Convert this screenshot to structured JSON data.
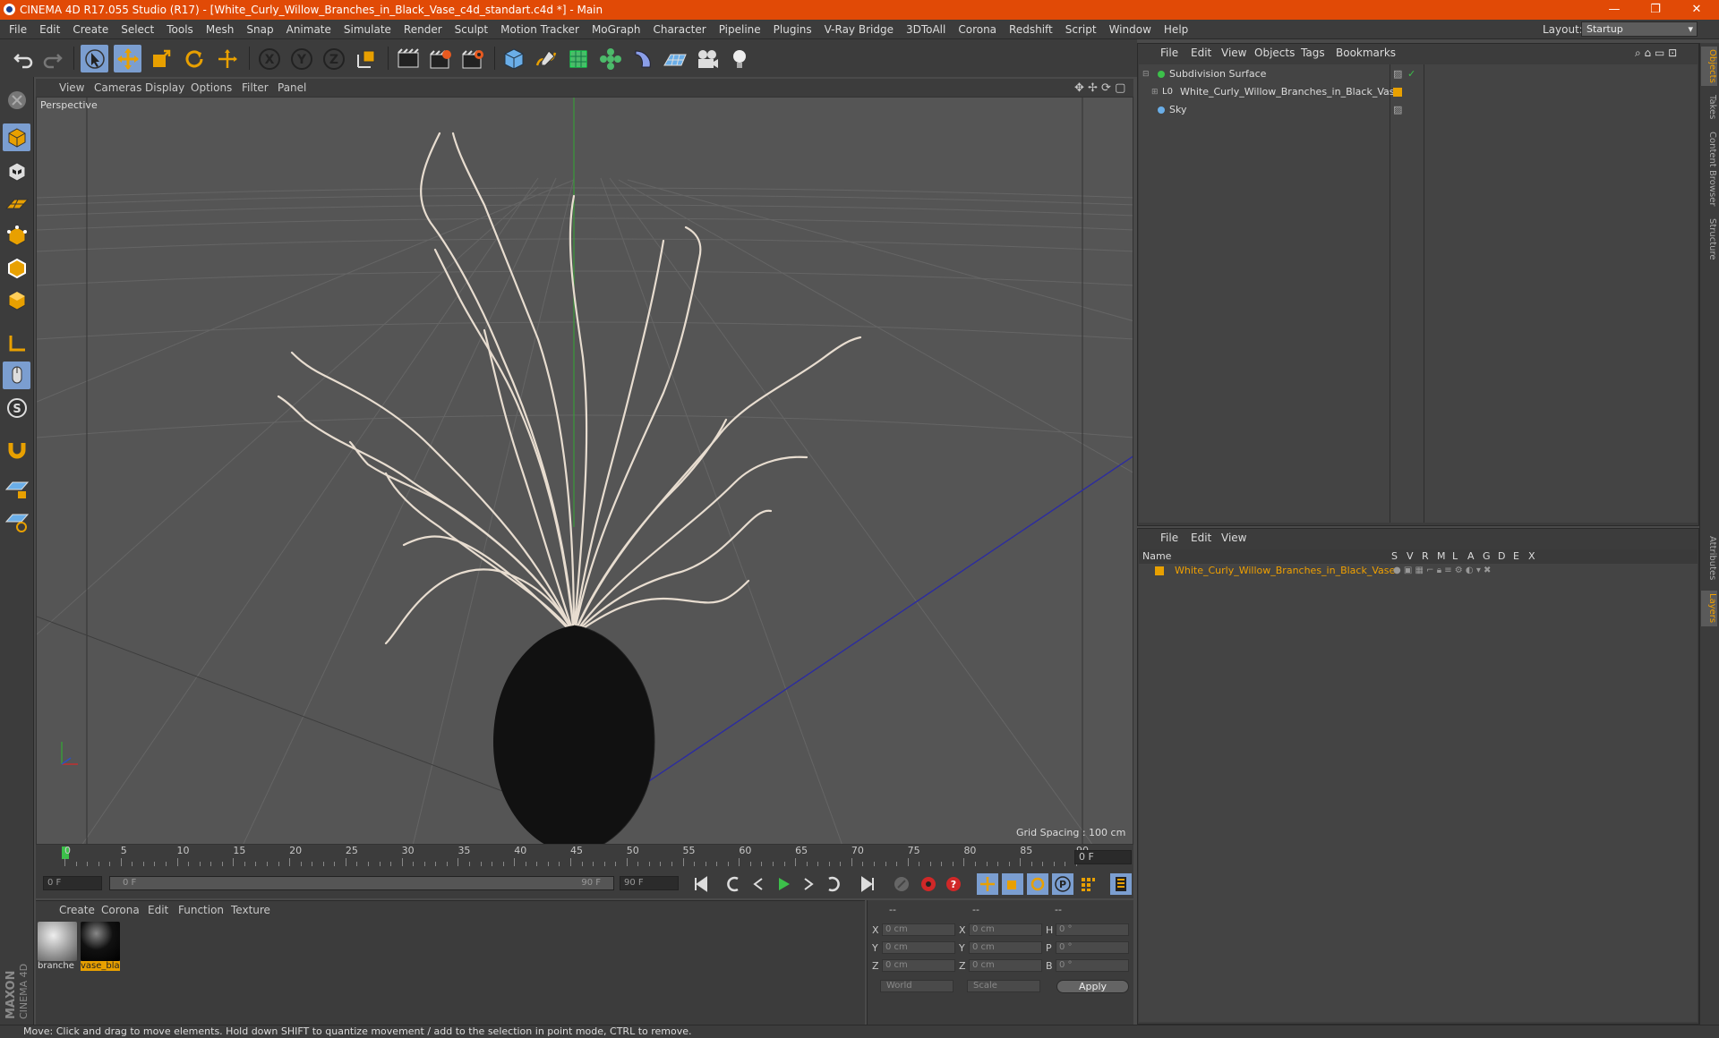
{
  "app": {
    "title": "CINEMA 4D R17.055 Studio (R17) - [White_Curly_Willow_Branches_in_Black_Vase_c4d_standart.c4d *] - Main",
    "window_controls": [
      "—",
      "❐",
      "✕"
    ]
  },
  "menubar": {
    "items": [
      "File",
      "Edit",
      "Create",
      "Select",
      "Tools",
      "Mesh",
      "Snap",
      "Animate",
      "Simulate",
      "Render",
      "Sculpt",
      "Motion Tracker",
      "MoGraph",
      "Character",
      "Pipeline",
      "Plugins",
      "V-Ray Bridge",
      "3DToAll",
      "Corona",
      "Redshift",
      "Script",
      "Window",
      "Help"
    ],
    "layout_label": "Layout:",
    "layout_value": "Startup"
  },
  "toolbar": {
    "icons": [
      "undo-icon",
      "redo-icon",
      "select-arrow-icon",
      "move-icon",
      "scale-icon",
      "rotate-icon",
      "live-transform-icon",
      "x-axis-icon",
      "y-axis-icon",
      "z-axis-icon",
      "coordinate-system-icon",
      "render-view-icon",
      "render-picture-viewer-icon",
      "edit-render-settings-icon",
      "cube-icon",
      "pen-spline-icon",
      "subdivision-icon",
      "array-icon",
      "deformer-icon",
      "floor-icon",
      "camera-icon",
      "light-icon"
    ]
  },
  "viewport": {
    "menu": [
      "View",
      "Cameras",
      "Display",
      "Options",
      "Filter",
      "Panel"
    ],
    "label": "Perspective",
    "grid_spacing": "Grid Spacing : 100 cm"
  },
  "timeline": {
    "ticks": [
      "0",
      "5",
      "10",
      "15",
      "20",
      "25",
      "30",
      "35",
      "40",
      "45",
      "50",
      "55",
      "60",
      "65",
      "70",
      "75",
      "80",
      "85",
      "90"
    ],
    "current_frame": "0 F",
    "start_field": "0 F",
    "range_start": "0 F",
    "range_end": "90 F",
    "end_field": "90 F"
  },
  "materials": {
    "menu": [
      "Create",
      "Corona",
      "Edit",
      "Function",
      "Texture"
    ],
    "items": [
      {
        "name": "branche",
        "selected": false
      },
      {
        "name": "vase_bla",
        "selected": true
      }
    ]
  },
  "coordinates": {
    "headers": [
      "--",
      "--",
      "--"
    ],
    "rows": [
      {
        "axis": "X",
        "pos": "0 cm",
        "axis2": "X",
        "size": "0 cm",
        "rot_label": "H",
        "rot": "0 °"
      },
      {
        "axis": "Y",
        "pos": "0 cm",
        "axis2": "Y",
        "size": "0 cm",
        "rot_label": "P",
        "rot": "0 °"
      },
      {
        "axis": "Z",
        "pos": "0 cm",
        "axis2": "Z",
        "size": "0 cm",
        "rot_label": "B",
        "rot": "0 °"
      }
    ],
    "space": "World",
    "mode": "Scale",
    "apply": "Apply"
  },
  "objects_panel": {
    "menu": [
      "File",
      "Edit",
      "View",
      "Objects",
      "Tags",
      "Bookmarks"
    ],
    "items": [
      {
        "name": "Subdivision Surface",
        "icon": "subdivision-icon"
      },
      {
        "name": "White_Curly_Willow_Branches_in_Black_Vase",
        "icon": "null-icon"
      },
      {
        "name": "Sky",
        "icon": "sky-icon"
      }
    ]
  },
  "layers_panel": {
    "menu": [
      "File",
      "Edit",
      "View"
    ],
    "header_name": "Name",
    "header_flags": [
      "S",
      "V",
      "R",
      "M",
      "L",
      "A",
      "G",
      "D",
      "E",
      "X"
    ],
    "items": [
      {
        "name": "White_Curly_Willow_Branches_in_Black_Vase",
        "color": "#e8a000"
      }
    ]
  },
  "right_tabs": [
    "Objects",
    "Takes",
    "Content Browser",
    "Structure",
    "Attributes",
    "Layers"
  ],
  "status": "Move: Click and drag to move elements. Hold down SHIFT to quantize movement / add to the selection in point mode, CTRL to remove.",
  "colors": {
    "title_bar": "#e14a06",
    "accent_active": "#7b9ed0",
    "layer_color": "#e8a000",
    "selection": "#f0a000"
  }
}
